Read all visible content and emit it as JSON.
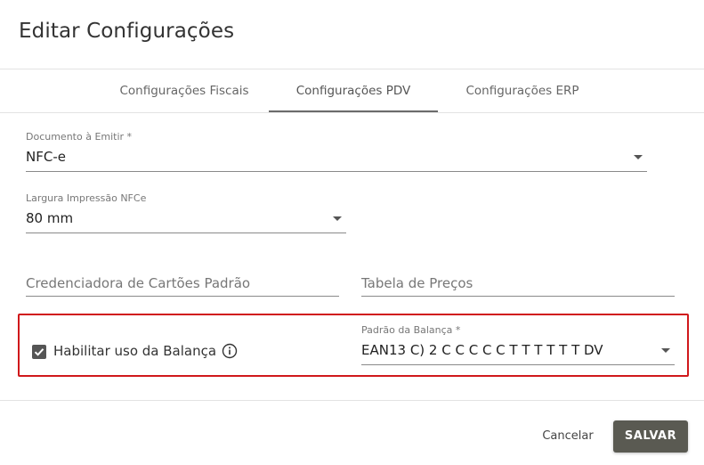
{
  "dialog": {
    "title": "Editar Configurações"
  },
  "tabs": [
    {
      "label": "Configurações Fiscais",
      "active": false
    },
    {
      "label": "Configurações PDV",
      "active": true
    },
    {
      "label": "Configurações ERP",
      "active": false
    }
  ],
  "form": {
    "documento": {
      "label": "Documento à Emitir *",
      "value": "NFC-e"
    },
    "largura": {
      "label": "Largura Impressão NFCe",
      "value": "80 mm"
    },
    "credenciadora": {
      "placeholder": "Credenciadora de Cartões Padrão"
    },
    "tabela": {
      "placeholder": "Tabela de Preços"
    },
    "balanca": {
      "checkbox_label": "Habilitar uso da Balança",
      "checked": true
    },
    "padrao_balanca": {
      "label": "Padrão da Balança *",
      "value": "EAN13 C) 2 C C C C C T T T T T T DV"
    }
  },
  "footer": {
    "cancel_label": "Cancelar",
    "save_label": "SALVAR"
  },
  "colors": {
    "highlight_border": "#d0181b",
    "save_button": "#5a5a52",
    "checkbox": "#555555"
  }
}
